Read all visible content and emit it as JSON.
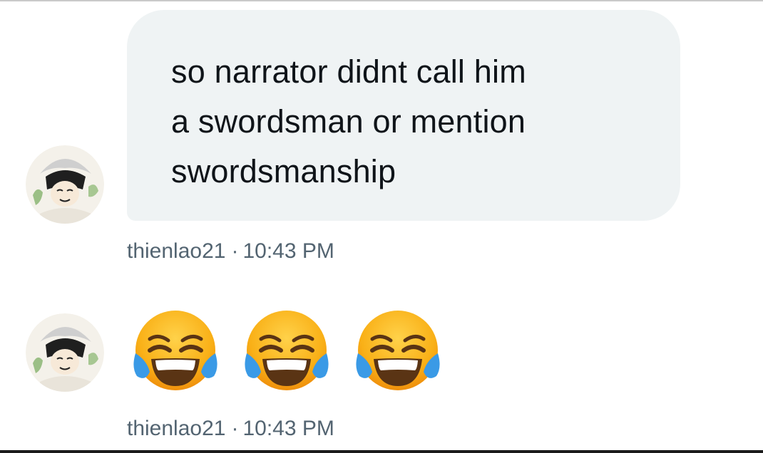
{
  "messages": [
    {
      "sender": "thienlao21",
      "time": "10:43 PM",
      "text": "so narrator didnt call him\na swordsman or mention\nswordsmanship"
    },
    {
      "sender": "thienlao21",
      "time": "10:43 PM",
      "emojis": [
        "face-with-tears-of-joy-icon",
        "face-with-tears-of-joy-icon",
        "face-with-tears-of-joy-icon"
      ]
    }
  ],
  "separator": "·",
  "colors": {
    "bubble": "#eff3f4",
    "text": "#0f1419",
    "meta": "#536471"
  }
}
